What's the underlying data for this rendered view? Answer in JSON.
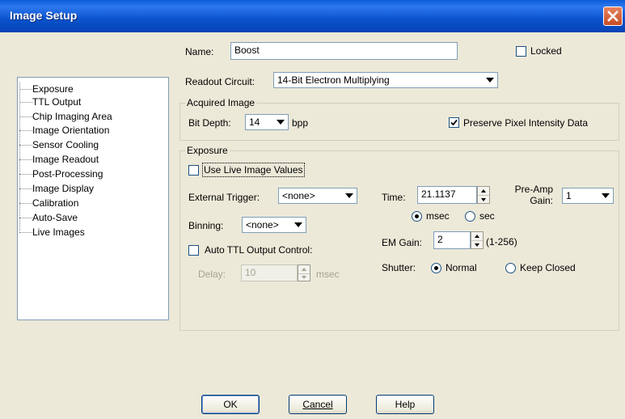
{
  "window": {
    "title": "Image Setup"
  },
  "nav_items": [
    "Exposure",
    "TTL Output",
    "Chip Imaging Area",
    "Image Orientation",
    "Sensor Cooling",
    "Image Readout",
    "Post-Processing",
    "Image Display",
    "Calibration",
    "Auto-Save",
    "Live Images"
  ],
  "name": {
    "label": "Name:",
    "value": "Boost"
  },
  "locked": {
    "label": "Locked",
    "checked": false
  },
  "readout": {
    "label": "Readout Circuit:",
    "value": "14-Bit Electron Multiplying"
  },
  "acquired": {
    "title": "Acquired Image",
    "bit_depth_label": "Bit Depth:",
    "bit_depth_value": "14",
    "bpp": "bpp",
    "preserve_label": "Preserve Pixel Intensity Data",
    "preserve_checked": true
  },
  "exposure": {
    "title": "Exposure",
    "use_live_label": "Use Live Image Values",
    "use_live_checked": false,
    "trigger_label": "External Trigger:",
    "trigger_value": "<none>",
    "binning_label": "Binning:",
    "binning_value": "<none>",
    "auto_ttl_label": "Auto TTL Output Control:",
    "auto_ttl_checked": false,
    "delay_label": "Delay:",
    "delay_value": "10",
    "delay_unit": "msec",
    "time_label": "Time:",
    "time_value": "21.1137",
    "preamp_label_1": "Pre-Amp",
    "preamp_label_2": "Gain:",
    "preamp_value": "1",
    "msec_label": "msec",
    "sec_label": "sec",
    "time_unit_selected": "msec",
    "em_gain_label": "EM Gain:",
    "em_gain_value": "2",
    "em_gain_range": "(1-256)",
    "shutter_label": "Shutter:",
    "shutter_normal": "Normal",
    "shutter_keep_closed": "Keep Closed",
    "shutter_selected": "Normal"
  },
  "buttons": {
    "ok": "OK",
    "cancel": "Cancel",
    "help": "Help"
  }
}
